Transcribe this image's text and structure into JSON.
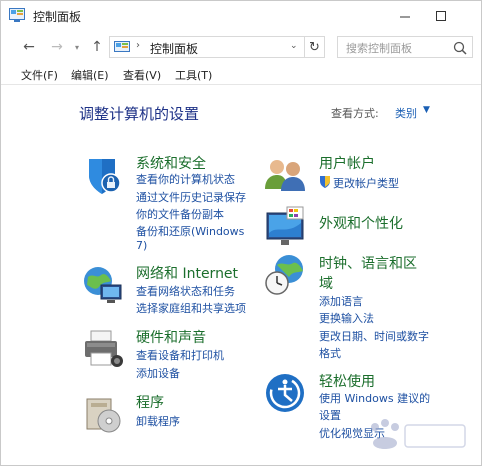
{
  "window": {
    "title": "控制面板"
  },
  "nav": {
    "address": "控制面板",
    "search_placeholder": "搜索控制面板"
  },
  "menu": [
    "文件(F)",
    "编辑(E)",
    "查看(V)",
    "工具(T)"
  ],
  "content": {
    "heading": "调整计算机的设置",
    "view_by_label": "查看方式:",
    "view_by_value": "类别"
  },
  "categories": [
    {
      "title": "系统和安全",
      "links": [
        "查看你的计算机状态",
        "通过文件历史记录保存",
        "你的文件备份副本",
        "备份和还原(Windows",
        "7)"
      ]
    },
    {
      "title": "网络和 Internet",
      "links": [
        "查看网络状态和任务",
        "选择家庭组和共享选项"
      ]
    },
    {
      "title": "硬件和声音",
      "links": [
        "查看设备和打印机",
        "添加设备"
      ]
    },
    {
      "title": "程序",
      "links": [
        "卸载程序"
      ]
    },
    {
      "title": "用户帐户",
      "links": [
        "更改帐户类型"
      ]
    },
    {
      "title": "外观和个性化",
      "links": []
    },
    {
      "title": "时钟、语言和区",
      "title2": "域",
      "links": [
        "添加语言",
        "更换输入法",
        "更改日期、时间或数字",
        "格式"
      ]
    },
    {
      "title": "轻松使用",
      "links": [
        "使用 Windows 建议的",
        "设置",
        "优化视觉显示"
      ]
    }
  ],
  "colors": {
    "heading": "#1e3287",
    "category_title": "#1b6e2c",
    "link": "#1e50a2"
  }
}
